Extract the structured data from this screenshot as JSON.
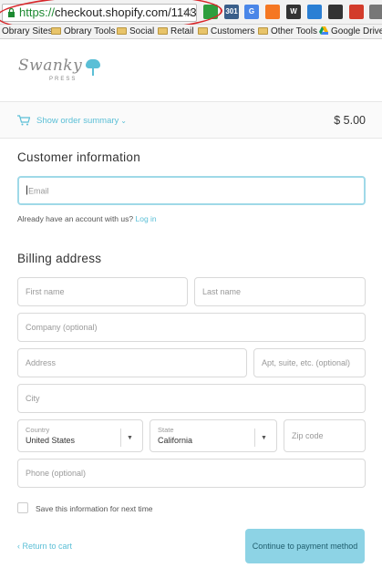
{
  "browser": {
    "url_scheme": "https://",
    "url_host": "checkout.shopify.com/11",
    "url_tail": "43",
    "extensions": [
      {
        "icon": "green-refresh-icon",
        "label": "",
        "color": "#2e9e3e"
      },
      {
        "icon": "redirect-301-icon",
        "label": "301",
        "color": "#3a5f8a"
      },
      {
        "icon": "translate-icon",
        "label": "G",
        "color": "#4a86e8"
      },
      {
        "icon": "hubspot-icon",
        "label": "",
        "color": "#f57722"
      },
      {
        "icon": "wordpress-icon",
        "label": "W",
        "color": "#333333"
      },
      {
        "icon": "download-icon",
        "label": "",
        "color": "#2a7fd4"
      },
      {
        "icon": "checklist-icon",
        "label": "",
        "color": "#333333"
      },
      {
        "icon": "no-entry-icon",
        "label": "",
        "color": "#d33c2b"
      },
      {
        "icon": "tools-icon",
        "label": "",
        "color": "#777777"
      }
    ],
    "bookmarks": [
      {
        "label": "Obrary Sites",
        "icon": "folder-icon"
      },
      {
        "label": "Obrary Tools",
        "icon": "folder-icon"
      },
      {
        "label": "Social",
        "icon": "folder-icon"
      },
      {
        "label": "Retail",
        "icon": "folder-icon"
      },
      {
        "label": "Customers",
        "icon": "folder-icon"
      },
      {
        "label": "Other Tools",
        "icon": "folder-icon"
      },
      {
        "label": "Google Drive",
        "icon": "google-drive-icon"
      }
    ]
  },
  "store": {
    "logo_script": "Swanky",
    "logo_sub": "PRESS"
  },
  "summary": {
    "toggle_label": "Show order summary",
    "total": "$ 5.00"
  },
  "customer": {
    "title": "Customer information",
    "email_placeholder": "Email",
    "account_prompt": "Already have an account with us?",
    "login_link": "Log in"
  },
  "billing": {
    "title": "Billing address",
    "first_name": "First name",
    "last_name": "Last name",
    "company": "Company (optional)",
    "address": "Address",
    "apt": "Apt, suite, etc. (optional)",
    "city": "City",
    "country_label": "Country",
    "country_value": "United States",
    "state_label": "State",
    "state_value": "California",
    "zip": "Zip code",
    "phone": "Phone (optional)",
    "save_info": "Save this information for next time"
  },
  "footer": {
    "return_link": "Return to cart",
    "continue_button": "Continue to payment method"
  },
  "colors": {
    "accent": "#5bbfd6",
    "button_bg": "#8dd3e5",
    "annotation_circle": "#d8262a"
  }
}
